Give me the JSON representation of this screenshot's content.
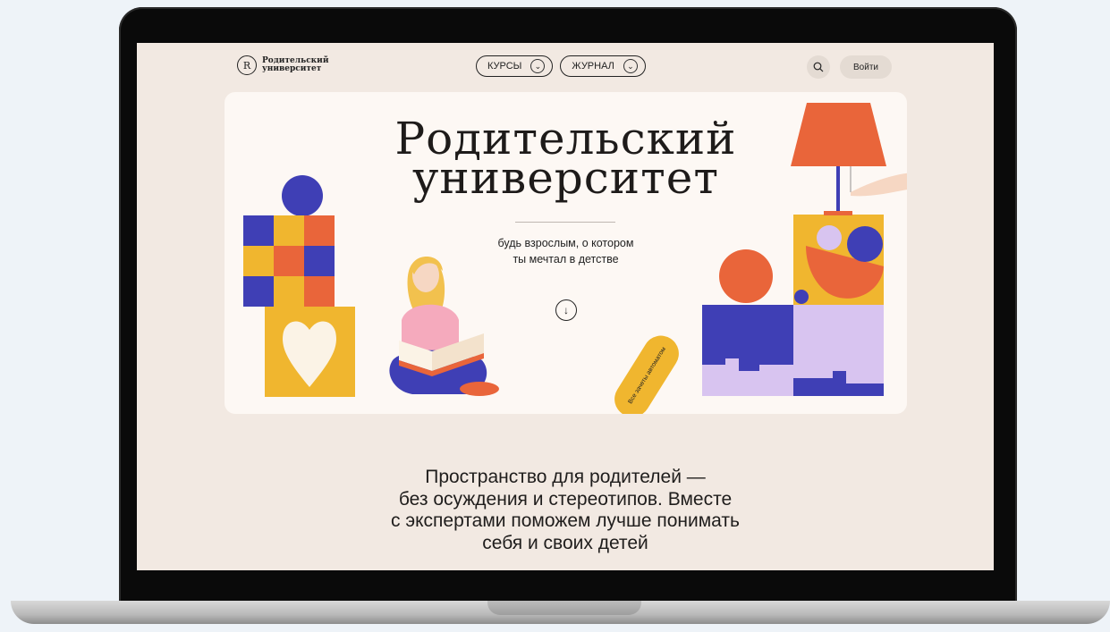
{
  "header": {
    "logo_text_line1": "Родительский",
    "logo_text_line2": "университет",
    "logo_mark": "R",
    "nav": [
      {
        "label": "КУРСЫ",
        "icon": "chevron-down-icon"
      },
      {
        "label": "ЖУРНАЛ",
        "icon": "chevron-down-icon"
      }
    ],
    "search_icon": "search-icon",
    "login_label": "Войти"
  },
  "hero": {
    "title_line1": "Родительский",
    "title_line2": "университет",
    "subtitle_line1": "будь взрослым, о котором",
    "subtitle_line2": "ты мечтал в детстве",
    "scroll_icon": "arrow-down-icon",
    "pill_text": "Все зачеты автоматом"
  },
  "tagline": {
    "line1": "Пространство для родителей —",
    "line2": "без осуждения и стереотипов. Вместе",
    "line3": "с экспертами поможем лучше понимать",
    "line4": "себя и своих детей"
  },
  "colors": {
    "page_bg": "#f2e9e2",
    "hero_bg": "#fdf8f4",
    "blue": "#3f3fb5",
    "orange": "#e9653a",
    "yellow": "#f0b62f",
    "lilac": "#d8c4f0"
  }
}
